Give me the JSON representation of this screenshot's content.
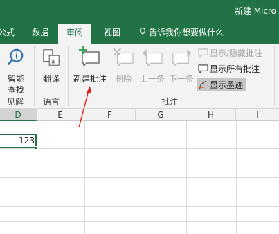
{
  "window": {
    "title": "新建 Micro"
  },
  "tabs": [
    {
      "label": "公式"
    },
    {
      "label": "数据"
    },
    {
      "label": "审阅"
    },
    {
      "label": "视图"
    }
  ],
  "tell_me": {
    "text": "告诉我你想要做什么"
  },
  "ribbon": {
    "insights": {
      "button": "智能\n查找",
      "btn_line1": "智能",
      "btn_line2": "查找",
      "group": "见解"
    },
    "language": {
      "button": "翻译",
      "group": "语言"
    },
    "comments": {
      "new_comment": "新建批注",
      "delete": "删除",
      "previous": "上一条",
      "next": "下一条",
      "show_hide": "显示/隐藏批注",
      "show_all": "显示所有批注",
      "show_ink": "显示墨迹",
      "group": "批注"
    }
  },
  "columns": [
    "D",
    "E",
    "F",
    "G",
    "H",
    "I"
  ],
  "active_column": "D",
  "cell": {
    "value": "123"
  },
  "colors": {
    "brand": "#217346",
    "disabled": "#a7a7a7",
    "annotation_arrow": "#e02020"
  }
}
